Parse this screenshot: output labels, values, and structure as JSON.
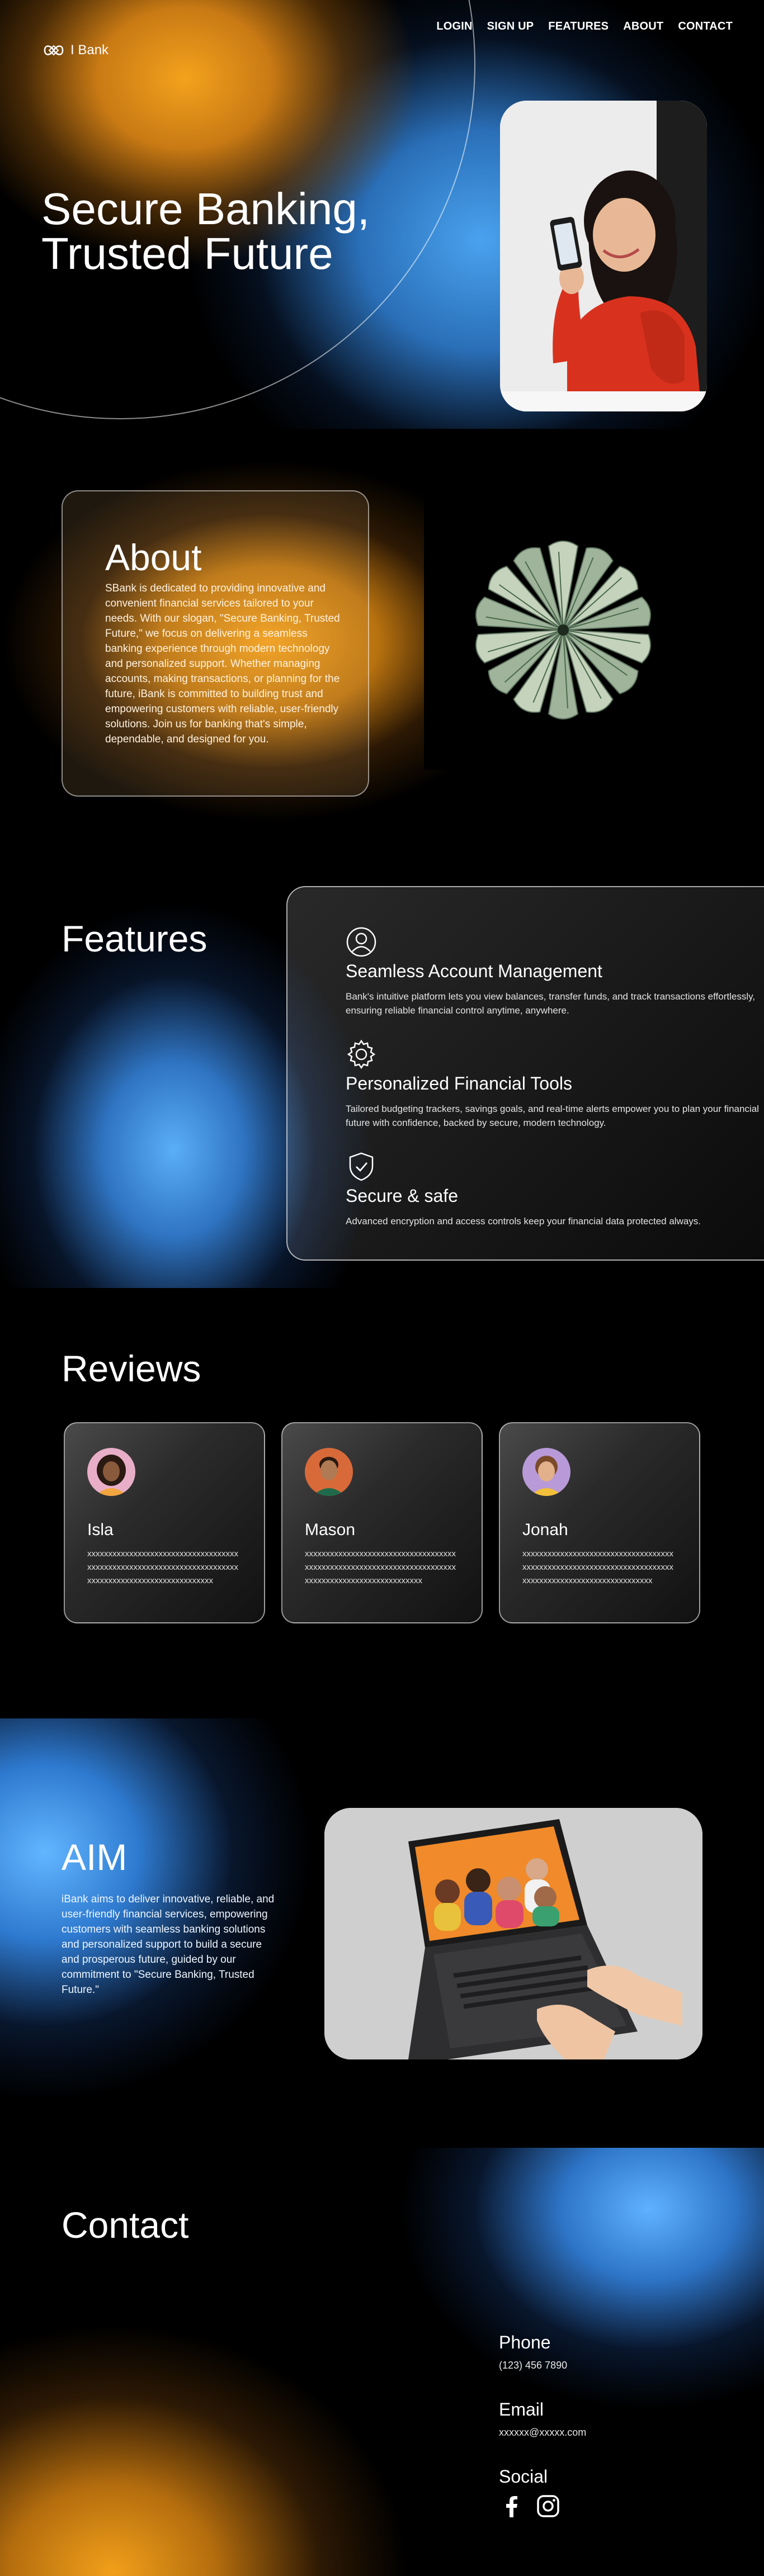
{
  "brand": {
    "name": "I Bank",
    "logo_icon": "infinity-logo-icon"
  },
  "nav": [
    {
      "label": "LOGIN"
    },
    {
      "label": "SIGN UP"
    },
    {
      "label": "FEATURES"
    },
    {
      "label": "ABOUT"
    },
    {
      "label": "CONTACT"
    }
  ],
  "hero": {
    "title_line1": "Secure Banking,",
    "title_line2": "Trusted Future"
  },
  "about": {
    "title": "About",
    "body": "SBank is dedicated to providing innovative and convenient financial services tailored to your needs. With our slogan, \"Secure Banking, Trusted Future,\" we focus on delivering a seamless banking experience through modern technology and personalized support. Whether managing accounts, making transactions, or planning for the future, iBank is committed to building trust and empowering customers with reliable, user-friendly solutions. Join us for banking that's simple, dependable, and designed for you."
  },
  "features": {
    "title": "Features",
    "items": [
      {
        "icon": "user-circle-icon",
        "title": "Seamless Account Management",
        "body": "Bank's intuitive platform lets you view balances, transfer funds, and track transactions effortlessly, ensuring reliable financial control anytime, anywhere."
      },
      {
        "icon": "gear-icon",
        "title": "Personalized Financial Tools",
        "body": "Tailored budgeting trackers, savings goals, and real-time alerts empower you to plan your financial future with confidence, backed by secure, modern technology."
      },
      {
        "icon": "shield-check-icon",
        "title": "Secure & safe",
        "body": "Advanced encryption and access controls keep your financial data protected always."
      }
    ]
  },
  "reviews": {
    "title": "Reviews",
    "items": [
      {
        "name": "Isla",
        "text": "xxxxxxxxxxxxxxxxxxxxxxxxxxxxxxxxxxxxxxxxxxxxxxxxxxxxxxxxxxxxxxxxxxxxxxxxxxxxxxxxxxxxxxxxxxxxxxxxxxxxxx"
      },
      {
        "name": "Mason",
        "text": "xxxxxxxxxxxxxxxxxxxxxxxxxxxxxxxxxxxxxxxxxxxxxxxxxxxxxxxxxxxxxxxxxxxxxxxxxxxxxxxxxxxxxxxxxxxxxxxxxxxx"
      },
      {
        "name": "Jonah",
        "text": "xxxxxxxxxxxxxxxxxxxxxxxxxxxxxxxxxxxxxxxxxxxxxxxxxxxxxxxxxxxxxxxxxxxxxxxxxxxxxxxxxxxxxxxxxxxxxxxxxxxxxxx"
      }
    ]
  },
  "aim": {
    "title": "AIM",
    "body": "iBank aims to deliver innovative, reliable, and user-friendly financial services, empowering customers with seamless banking solutions and personalized support to build a secure and prosperous future, guided by our commitment to \"Secure Banking, Trusted Future.\""
  },
  "contact": {
    "title": "Contact",
    "phone_label": "Phone",
    "phone_value": "(123) 456 7890",
    "email_label": "Email",
    "email_value": "xxxxxx@xxxxx.com",
    "social_label": "Social",
    "social_icons": [
      "facebook-icon",
      "instagram-icon"
    ]
  },
  "colors": {
    "accent_orange": "#f3a21c",
    "accent_blue": "#4aa2ee",
    "background": "#000000"
  }
}
